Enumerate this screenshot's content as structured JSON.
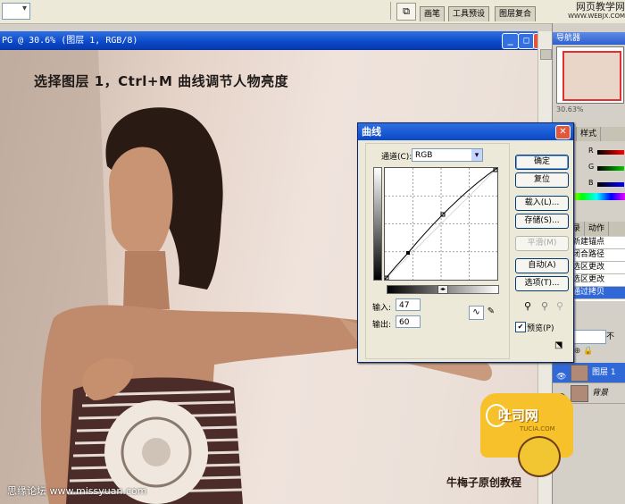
{
  "top_bar": {
    "palette_tabs": [
      "画笔",
      "工具预设",
      "图层复合"
    ],
    "site_watermark": "网页教学网",
    "site_url": "WWW.WEBJX.COM"
  },
  "document": {
    "title": "PG @ 30.6% (图层 1, RGB/8)",
    "caption": "选择图层 1，Ctrl+M 曲线调节人物亮度",
    "footer_left": "思缘论坛 www.missyuan.com",
    "footer_right": "牛梅子原创教程"
  },
  "navigator": {
    "title": "导航器",
    "zoom": "30.63%"
  },
  "color_tabs": [
    "",
    "色板",
    "样式"
  ],
  "color_channels": [
    "R",
    "G",
    "B"
  ],
  "history": {
    "tabs": [
      "史记录",
      "动作"
    ],
    "items": [
      "新建锚点",
      "闭合路径",
      "选区更改",
      "选区更改",
      "通过拷贝"
    ],
    "selected_index": 4
  },
  "layers": {
    "blend_mode": "",
    "opacity_label": "不",
    "rows": [
      {
        "name": "图层 1",
        "selected": true
      },
      {
        "name": "背景",
        "selected": false
      }
    ]
  },
  "curves_dialog": {
    "title": "曲线",
    "channel_label": "通道(C):",
    "channel_value": "RGB",
    "buttons": {
      "ok": "确定",
      "reset": "复位",
      "load": "载入(L)...",
      "save": "存储(S)...",
      "smooth": "平滑(M)",
      "auto": "自动(A)",
      "options": "选项(T)..."
    },
    "input_label": "输入:",
    "input_value": "47",
    "output_label": "输出:",
    "output_value": "60",
    "preview_label": "预览(P)",
    "preview_checked": true
  },
  "logo": {
    "text": "吐司网",
    "sub": "TUCIA.COM"
  }
}
